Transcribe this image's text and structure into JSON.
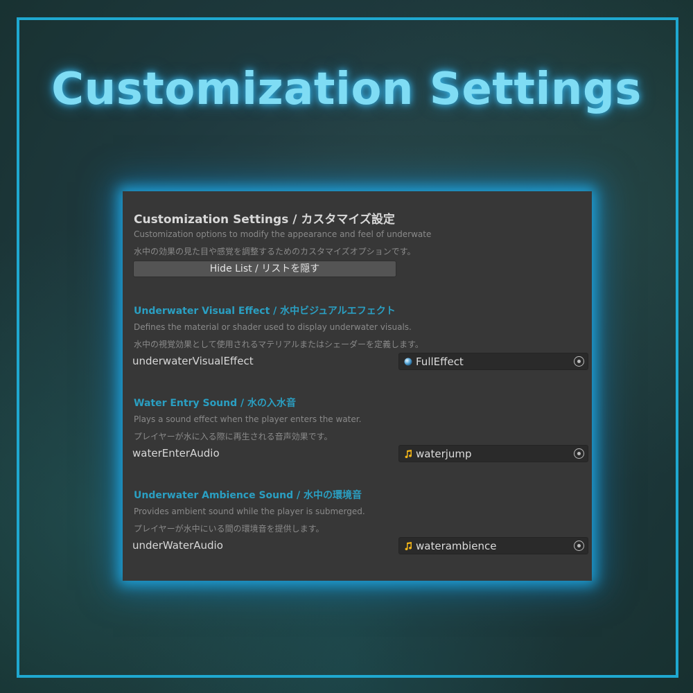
{
  "banner": {
    "title": "Customization Settings"
  },
  "panel": {
    "heading": "Customization Settings / カスタマイズ設定",
    "desc_en": "Customization options to modify the appearance and feel of underwate",
    "desc_ja": "水中の効果の見た目や感覚を調整するためのカスタマイズオプションです。",
    "hide_button": "Hide List / リストを隠す"
  },
  "sections": [
    {
      "title": "Underwater Visual Effect / 水中ビジュアルエフェクト",
      "desc_en": "Defines the material or shader used to display underwater visuals.",
      "desc_ja": "水中の視覚効果として使用されるマテリアルまたはシェーダーを定義します。",
      "field_label": "underwaterVisualEffect",
      "field_value": "FullEffect",
      "icon": "material-sphere-icon"
    },
    {
      "title": "Water Entry Sound / 水の入水音",
      "desc_en": "Plays a sound effect when the player enters the water.",
      "desc_ja": "プレイヤーが水に入る際に再生される音声効果です。",
      "field_label": "waterEnterAudio",
      "field_value": "waterjump",
      "icon": "audio-clip-icon"
    },
    {
      "title": "Underwater Ambience Sound / 水中の環境音",
      "desc_en": "Provides ambient sound while the player is submerged.",
      "desc_ja": "プレイヤーが水中にいる間の環境音を提供します。",
      "field_label": "underWaterAudio",
      "field_value": "waterambience",
      "icon": "audio-clip-icon"
    }
  ],
  "colors": {
    "accent": "#1fa8d0",
    "section_title": "#2a9fc2",
    "panel_bg": "#373737",
    "title_glow": "#7fdcf4"
  }
}
